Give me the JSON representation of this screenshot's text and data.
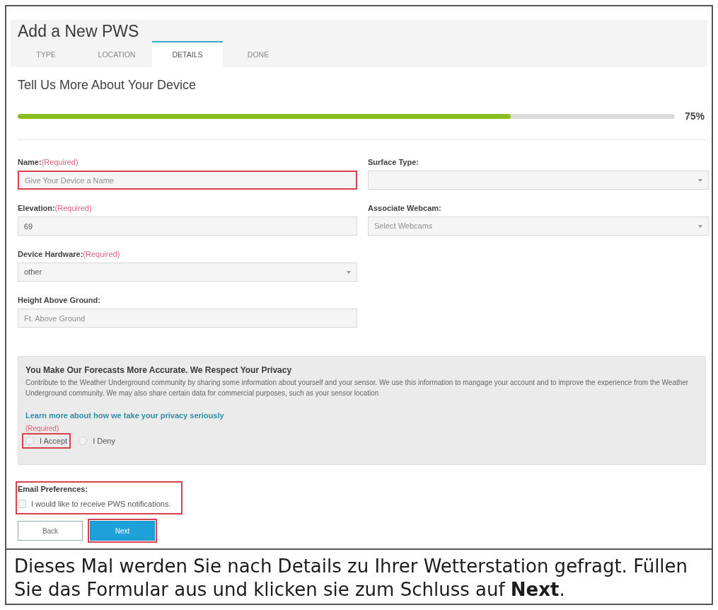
{
  "header": {
    "title": "Add a New PWS"
  },
  "tabs": [
    {
      "label": "TYPE",
      "selected": false
    },
    {
      "label": "LOCATION",
      "selected": false
    },
    {
      "label": "DETAILS",
      "selected": true
    },
    {
      "label": "DONE",
      "selected": false
    }
  ],
  "section_title": "Tell Us More About Your Device",
  "progress": {
    "level": 0.75,
    "reading": "75%"
  },
  "form": {
    "left": [
      {
        "kind": "input",
        "label": "Name:",
        "required": "(Required)",
        "placeholder": "Give Your Device a Name",
        "highlighted": true
      },
      {
        "kind": "input",
        "label": "Elevation:",
        "required": "(Required)",
        "value": "69",
        "highlighted": false
      },
      {
        "kind": "select",
        "label": "Device Hardware:",
        "required": "(Required)",
        "value": "other",
        "highlighted": false
      },
      {
        "kind": "input",
        "label": "Height Above Ground:",
        "placeholder": "Ft. Above Ground",
        "highlighted": false
      }
    ],
    "right": [
      {
        "kind": "select",
        "label": "Surface Type:"
      },
      {
        "kind": "select",
        "label": "Associate Webcam:",
        "placeholder": "Select Webcams"
      }
    ]
  },
  "privacy": {
    "title": "You Make Our Forecasts More Accurate. We Respect Your Privacy",
    "text": "Contribute to the Weather Underground community by sharing some information about yourself and your sensor. We use this information to mangage your account and to improve the experience from the Weather Underground community. We may also share certain data for commercial purposes, such as your sensor location",
    "link": "Learn more about how we take your privacy seriously",
    "required": "(Required)",
    "options": [
      {
        "label": "I Accept",
        "selected": false,
        "highlighted": true
      },
      {
        "label": "I Deny",
        "selected": false,
        "highlighted": false
      }
    ]
  },
  "email_preferences": {
    "title": "Email Preferences:",
    "highlighted": true,
    "option": {
      "label": "I would like to receive PWS notifications.",
      "checked": false
    }
  },
  "buttons": [
    {
      "label": "Back",
      "kind": "secondary",
      "highlighted": false
    },
    {
      "label": "Next",
      "kind": "primary",
      "highlighted": true
    }
  ],
  "caption": "Dieses Mal werden Sie nach Details zu Ihrer Wetterstation gefragt. Füllen Sie das Formular aus und klicken sie zum Schluss auf **Next**."
}
